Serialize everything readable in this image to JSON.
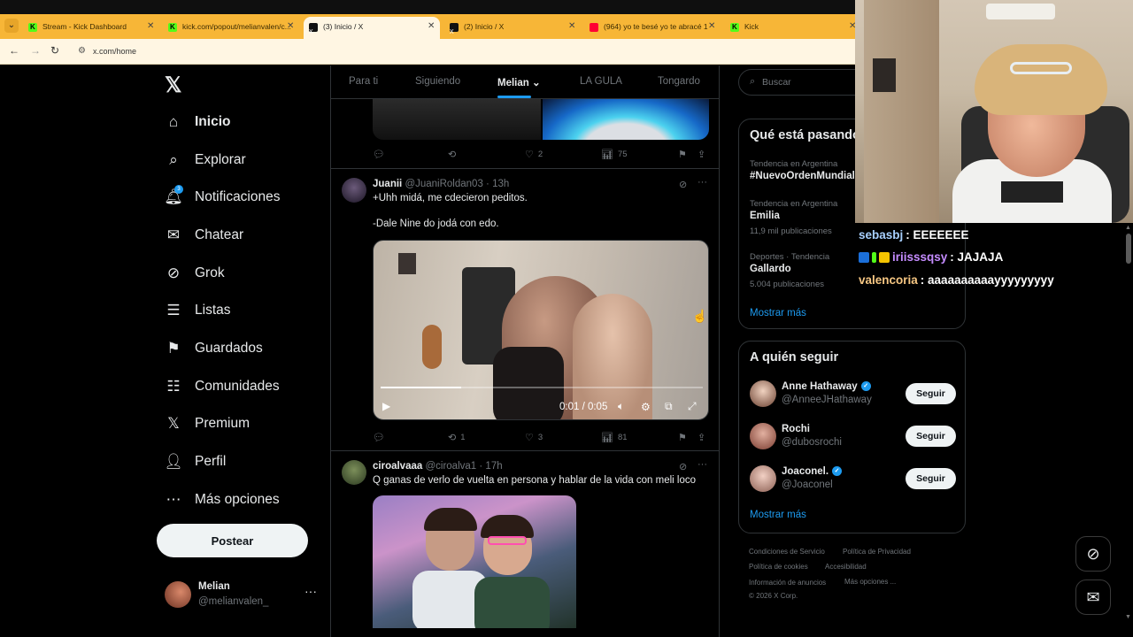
{
  "browser": {
    "tabs": [
      {
        "title": "Stream - Kick Dashboard",
        "favicon": "kick-icon",
        "active": false
      },
      {
        "title": "kick.com/popout/melianvalen/c...",
        "favicon": "kick-icon",
        "active": false
      },
      {
        "title": "(3) Inicio / X",
        "favicon": "x-icon",
        "active": true
      },
      {
        "title": "(2) Inicio / X",
        "favicon": "x-icon",
        "active": false
      },
      {
        "title": "(964) yo te besé yo te abracé 1",
        "favicon": "youtube-icon",
        "active": false
      },
      {
        "title": "Kick",
        "favicon": "kick-icon",
        "active": false
      }
    ],
    "url": "x.com/home",
    "tab_color": "#f7b637"
  },
  "nav": {
    "items": [
      {
        "label": "Inicio",
        "icon": "home-icon",
        "active": true
      },
      {
        "label": "Explorar",
        "icon": "search-icon"
      },
      {
        "label": "Notificaciones",
        "icon": "bell-icon",
        "badge": "3"
      },
      {
        "label": "Chatear",
        "icon": "mail-icon"
      },
      {
        "label": "Grok",
        "icon": "grok-icon"
      },
      {
        "label": "Listas",
        "icon": "list-icon"
      },
      {
        "label": "Guardados",
        "icon": "bookmark-icon"
      },
      {
        "label": "Comunidades",
        "icon": "communities-icon"
      },
      {
        "label": "Premium",
        "icon": "x-logo-icon"
      },
      {
        "label": "Perfil",
        "icon": "person-icon"
      },
      {
        "label": "Más opciones",
        "icon": "more-circle-icon"
      }
    ],
    "post_label": "Postear",
    "profile": {
      "name": "Melian",
      "handle": "@melianvalen_"
    }
  },
  "timeline": {
    "tabs": [
      "Para ti",
      "Siguiendo",
      "Melian",
      "LA GULA",
      "Tongardo"
    ],
    "active_tab": "Melian",
    "first_tweet_stats": {
      "reply": "",
      "retweet": "",
      "like": "2",
      "views": "75"
    },
    "tweets": [
      {
        "name": "Juanii",
        "handle": "@JuaniRoldan03",
        "time": "13h",
        "lines": [
          "+Uhh midá, me cdecieron peditos.",
          "-Dale Nine do jodá con edo."
        ],
        "video_time": "0:01 / 0:05",
        "video_progress": 0.25,
        "stats": {
          "reply": "",
          "retweet": "1",
          "like": "3",
          "views": "81"
        }
      },
      {
        "name": "ciroalvaaa",
        "handle": "@ciroalva1",
        "time": "17h",
        "lines": [
          "Q ganas de verlo de vuelta en persona y hablar de la vida con meli loco"
        ]
      }
    ]
  },
  "sidebar": {
    "search_placeholder": "Buscar",
    "trending_title": "Qué está pasando",
    "trends": [
      {
        "context": "Tendencia en Argentina",
        "name": "#NuevoOrdenMundial",
        "count": ""
      },
      {
        "context": "Tendencia en Argentina",
        "name": "Emilia",
        "count": "11,9 mil publicaciones"
      },
      {
        "context": "Deportes · Tendencia",
        "name": "Gallardo",
        "count": "5.004 publicaciones"
      }
    ],
    "show_more": "Mostrar más",
    "who_title": "A quién seguir",
    "follow_label": "Seguir",
    "who": [
      {
        "name": "Anne Hathaway",
        "handle": "@AnneeJHathaway",
        "verified": true
      },
      {
        "name": "Rochi",
        "handle": "@dubosrochi",
        "verified": false
      },
      {
        "name": "Joaconel.",
        "handle": "@Joaconel",
        "verified": true
      }
    ],
    "footer": [
      "Condiciones de Servicio",
      "Política de Privacidad",
      "Política de cookies",
      "Accesibilidad",
      "Información de anuncios",
      "Más opciones ...",
      "© 2026 X Corp."
    ]
  },
  "chat": [
    {
      "user": "sebasbj",
      "message": ": EEEEEEE",
      "color": "#a8d0ff"
    },
    {
      "user": "iriisssqsy",
      "message": ": JAJAJA",
      "color": "#c58cff"
    },
    {
      "user": "valencoria",
      "message": ": aaaaaaaaaayyyyyyyyy",
      "color": "#f7c783"
    }
  ],
  "colors": {
    "accent": "#1d9bf0",
    "background": "#000000",
    "kick_green": "#53fc18"
  }
}
